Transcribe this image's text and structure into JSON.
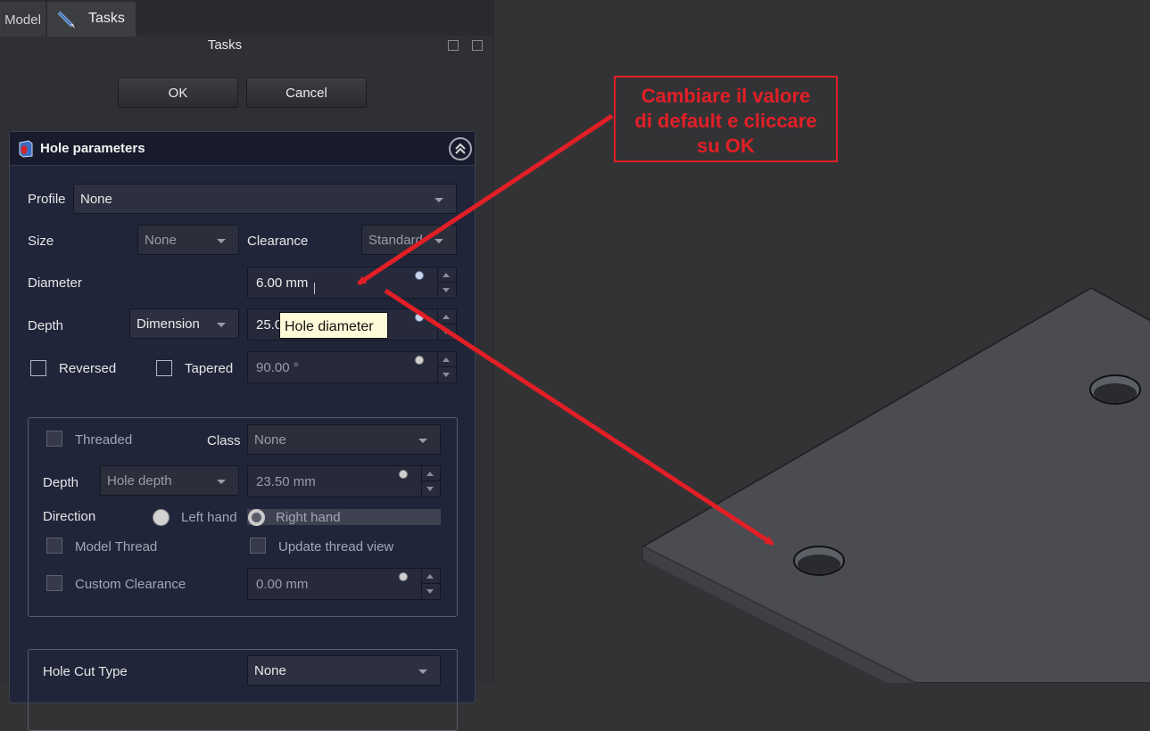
{
  "tabs": {
    "model": "Model",
    "tasks": "Tasks"
  },
  "tasks_panel": {
    "title": "Tasks",
    "ok": "OK",
    "cancel": "Cancel"
  },
  "hole": {
    "title": "Hole parameters",
    "profile": {
      "label": "Profile",
      "value": "None"
    },
    "size": {
      "label": "Size",
      "value": "None"
    },
    "clearance": {
      "label": "Clearance",
      "value": "Standard"
    },
    "diameter": {
      "label": "Diameter",
      "value": "6.00 mm"
    },
    "depth": {
      "label": "Depth",
      "type": "Dimension",
      "value": "25.0"
    },
    "tooltip": "Hole diameter",
    "reversed": "Reversed",
    "tapered": {
      "label": "Tapered",
      "value": "90.00 °"
    },
    "threaded": "Threaded",
    "class": {
      "label": "Class",
      "value": "None"
    },
    "thread_depth": {
      "label": "Depth",
      "type": "Hole depth",
      "value": "23.50 mm"
    },
    "direction": {
      "label": "Direction",
      "left": "Left hand",
      "right": "Right hand"
    },
    "model_thread": "Model Thread",
    "update_thread_view": "Update thread view",
    "custom_clearance": {
      "label": "Custom Clearance",
      "value": "0.00 mm"
    },
    "hole_cut": {
      "label": "Hole Cut Type",
      "value": "None"
    }
  },
  "annotation": {
    "line1": "Cambiare il valore",
    "line2": "di default e cliccare",
    "line3": "su OK"
  },
  "colors": {
    "accent_red": "#e21f26",
    "panel_bg": "#21253a",
    "plate": "#4a4c52"
  }
}
